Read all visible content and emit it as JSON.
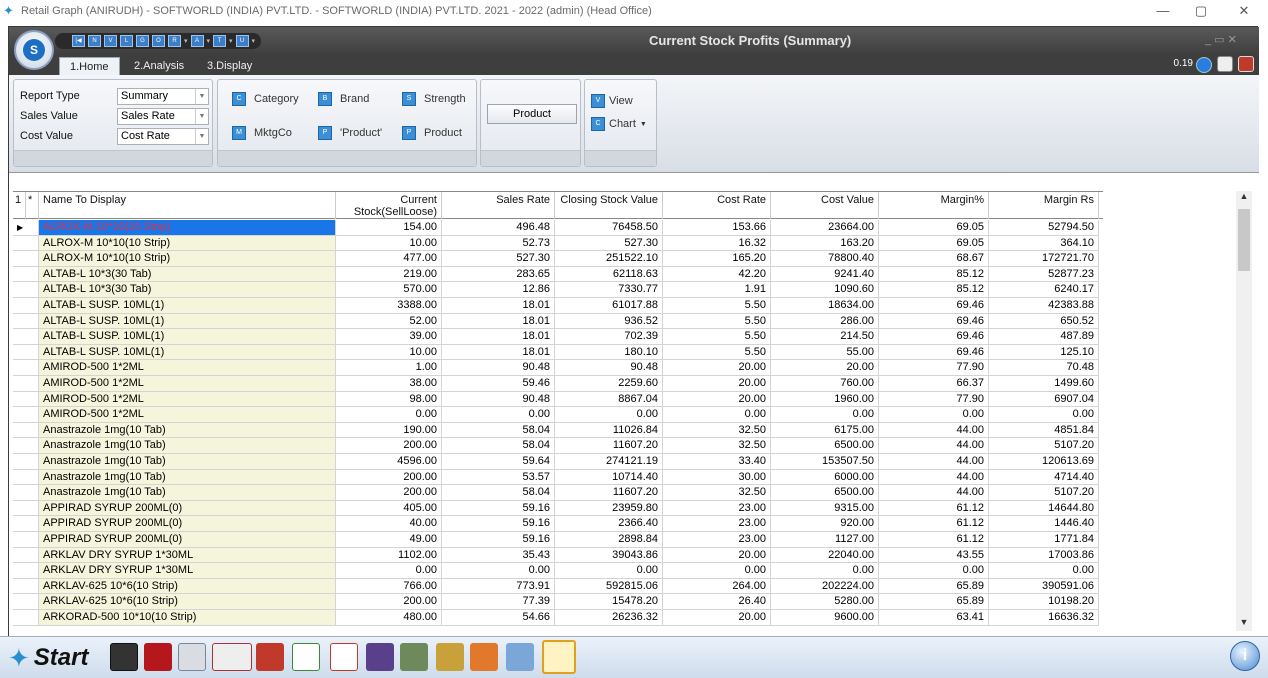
{
  "window": {
    "title": "Retail Graph (ANIRUDH) - SOFTWORLD (INDIA) PVT.LTD. - SOFTWORLD (INDIA) PVT.LTD.  2021 - 2022 (admin) (Head Office)",
    "minimize": "—",
    "restore": "▢",
    "close": "✕"
  },
  "app": {
    "title": "Current Stock Profits (Summary)",
    "orb_letter": "S",
    "frame_controls": "_  ▭  ✕",
    "zoom": "0.19"
  },
  "tabs": [
    {
      "label": "1.Home",
      "active": true
    },
    {
      "label": "2.Analysis",
      "active": false
    },
    {
      "label": "3.Display",
      "active": false
    }
  ],
  "report": {
    "report_type_label": "Report Type",
    "report_type_value": "Summary",
    "sales_value_label": "Sales Value",
    "sales_value_value": "Sales Rate",
    "cost_value_label": "Cost Value",
    "cost_value_value": "Cost Rate"
  },
  "groupby": {
    "category": "Category",
    "brand": "Brand",
    "strength": "Strength",
    "mktgco": "MktgCo",
    "product_quoted": "'Product'",
    "product": "Product"
  },
  "product_button": "Product",
  "view": {
    "view_label": "View",
    "chart_label": "Chart"
  },
  "grid": {
    "row_indicator_header": "1",
    "star_header": "*",
    "columns": {
      "name": "Name To Display",
      "current_stock": "Current Stock(SellLoose)",
      "sales_rate": "Sales Rate",
      "closing_value": "Closing Stock Value",
      "cost_rate": "Cost Rate",
      "cost_value": "Cost Value",
      "margin_pct": "Margin%",
      "margin_rs": "Margin Rs"
    },
    "rows": [
      [
        "ALROX-M 10*10(10 Strip)",
        "154.00",
        "496.48",
        "76458.50",
        "153.66",
        "23664.00",
        "69.05",
        "52794.50"
      ],
      [
        "ALROX-M 10*10(10 Strip)",
        "10.00",
        "52.73",
        "527.30",
        "16.32",
        "163.20",
        "69.05",
        "364.10"
      ],
      [
        "ALROX-M 10*10(10 Strip)",
        "477.00",
        "527.30",
        "251522.10",
        "165.20",
        "78800.40",
        "68.67",
        "172721.70"
      ],
      [
        "ALTAB-L 10*3(30 Tab)",
        "219.00",
        "283.65",
        "62118.63",
        "42.20",
        "9241.40",
        "85.12",
        "52877.23"
      ],
      [
        "ALTAB-L 10*3(30 Tab)",
        "570.00",
        "12.86",
        "7330.77",
        "1.91",
        "1090.60",
        "85.12",
        "6240.17"
      ],
      [
        "ALTAB-L SUSP. 10ML(1)",
        "3388.00",
        "18.01",
        "61017.88",
        "5.50",
        "18634.00",
        "69.46",
        "42383.88"
      ],
      [
        "ALTAB-L SUSP. 10ML(1)",
        "52.00",
        "18.01",
        "936.52",
        "5.50",
        "286.00",
        "69.46",
        "650.52"
      ],
      [
        "ALTAB-L SUSP. 10ML(1)",
        "39.00",
        "18.01",
        "702.39",
        "5.50",
        "214.50",
        "69.46",
        "487.89"
      ],
      [
        "ALTAB-L SUSP. 10ML(1)",
        "10.00",
        "18.01",
        "180.10",
        "5.50",
        "55.00",
        "69.46",
        "125.10"
      ],
      [
        "AMIROD-500 1*2ML",
        "1.00",
        "90.48",
        "90.48",
        "20.00",
        "20.00",
        "77.90",
        "70.48"
      ],
      [
        "AMIROD-500 1*2ML",
        "38.00",
        "59.46",
        "2259.60",
        "20.00",
        "760.00",
        "66.37",
        "1499.60"
      ],
      [
        "AMIROD-500 1*2ML",
        "98.00",
        "90.48",
        "8867.04",
        "20.00",
        "1960.00",
        "77.90",
        "6907.04"
      ],
      [
        "AMIROD-500 1*2ML",
        "0.00",
        "0.00",
        "0.00",
        "0.00",
        "0.00",
        "0.00",
        "0.00"
      ],
      [
        "Anastrazole 1mg(10 Tab)",
        "190.00",
        "58.04",
        "11026.84",
        "32.50",
        "6175.00",
        "44.00",
        "4851.84"
      ],
      [
        "Anastrazole 1mg(10 Tab)",
        "200.00",
        "58.04",
        "11607.20",
        "32.50",
        "6500.00",
        "44.00",
        "5107.20"
      ],
      [
        "Anastrazole 1mg(10 Tab)",
        "4596.00",
        "59.64",
        "274121.19",
        "33.40",
        "153507.50",
        "44.00",
        "120613.69"
      ],
      [
        "Anastrazole 1mg(10 Tab)",
        "200.00",
        "53.57",
        "10714.40",
        "30.00",
        "6000.00",
        "44.00",
        "4714.40"
      ],
      [
        "Anastrazole 1mg(10 Tab)",
        "200.00",
        "58.04",
        "11607.20",
        "32.50",
        "6500.00",
        "44.00",
        "5107.20"
      ],
      [
        "APPIRAD SYRUP 200ML(0)",
        "405.00",
        "59.16",
        "23959.80",
        "23.00",
        "9315.00",
        "61.12",
        "14644.80"
      ],
      [
        "APPIRAD SYRUP 200ML(0)",
        "40.00",
        "59.16",
        "2366.40",
        "23.00",
        "920.00",
        "61.12",
        "1446.40"
      ],
      [
        "APPIRAD SYRUP 200ML(0)",
        "49.00",
        "59.16",
        "2898.84",
        "23.00",
        "1127.00",
        "61.12",
        "1771.84"
      ],
      [
        "ARKLAV DRY SYRUP 1*30ML",
        "1102.00",
        "35.43",
        "39043.86",
        "20.00",
        "22040.00",
        "43.55",
        "17003.86"
      ],
      [
        "ARKLAV DRY SYRUP 1*30ML",
        "0.00",
        "0.00",
        "0.00",
        "0.00",
        "0.00",
        "0.00",
        "0.00"
      ],
      [
        "ARKLAV-625 10*6(10 Strip)",
        "766.00",
        "773.91",
        "592815.06",
        "264.00",
        "202224.00",
        "65.89",
        "390591.06"
      ],
      [
        "ARKLAV-625 10*6(10 Strip)",
        "200.00",
        "77.39",
        "15478.20",
        "26.40",
        "5280.00",
        "65.89",
        "10198.20"
      ],
      [
        "ARKORAD-500 10*10(10 Strip)",
        "480.00",
        "54.66",
        "26236.32",
        "20.00",
        "9600.00",
        "63.41",
        "16636.32"
      ]
    ]
  },
  "taskbar": {
    "start_label": "Start",
    "info": "i"
  }
}
